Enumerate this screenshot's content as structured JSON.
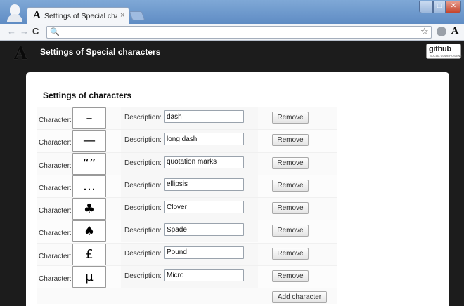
{
  "browser": {
    "tab_title": "Settings of Special characters",
    "tab_close": "×",
    "address_value": "",
    "icons": {
      "favicon": "A",
      "back": "←",
      "forward": "→",
      "reload": "C",
      "search": "🔍",
      "star": "☆",
      "extension": "A",
      "minimize": "–",
      "maximize": "□",
      "close": "✕"
    }
  },
  "header": {
    "logo": "A",
    "title": "Settings of Special characters",
    "github": "github",
    "github_sub": "SOCIAL CODE HOSTING"
  },
  "settings": {
    "title": "Settings of characters",
    "char_label": "Character:",
    "desc_label": "Description:",
    "remove_label": "Remove",
    "add_label": "Add character",
    "items": [
      {
        "char": "–",
        "description": "dash"
      },
      {
        "char": "—",
        "description": "long dash"
      },
      {
        "char": "“”",
        "description": "quotation marks"
      },
      {
        "char": "…",
        "description": "ellipsis"
      },
      {
        "char": "♣",
        "description": "Clover"
      },
      {
        "char": "♠",
        "description": "Spade"
      },
      {
        "char": "£",
        "description": "Pound"
      },
      {
        "char": "µ",
        "description": "Micro"
      }
    ]
  }
}
